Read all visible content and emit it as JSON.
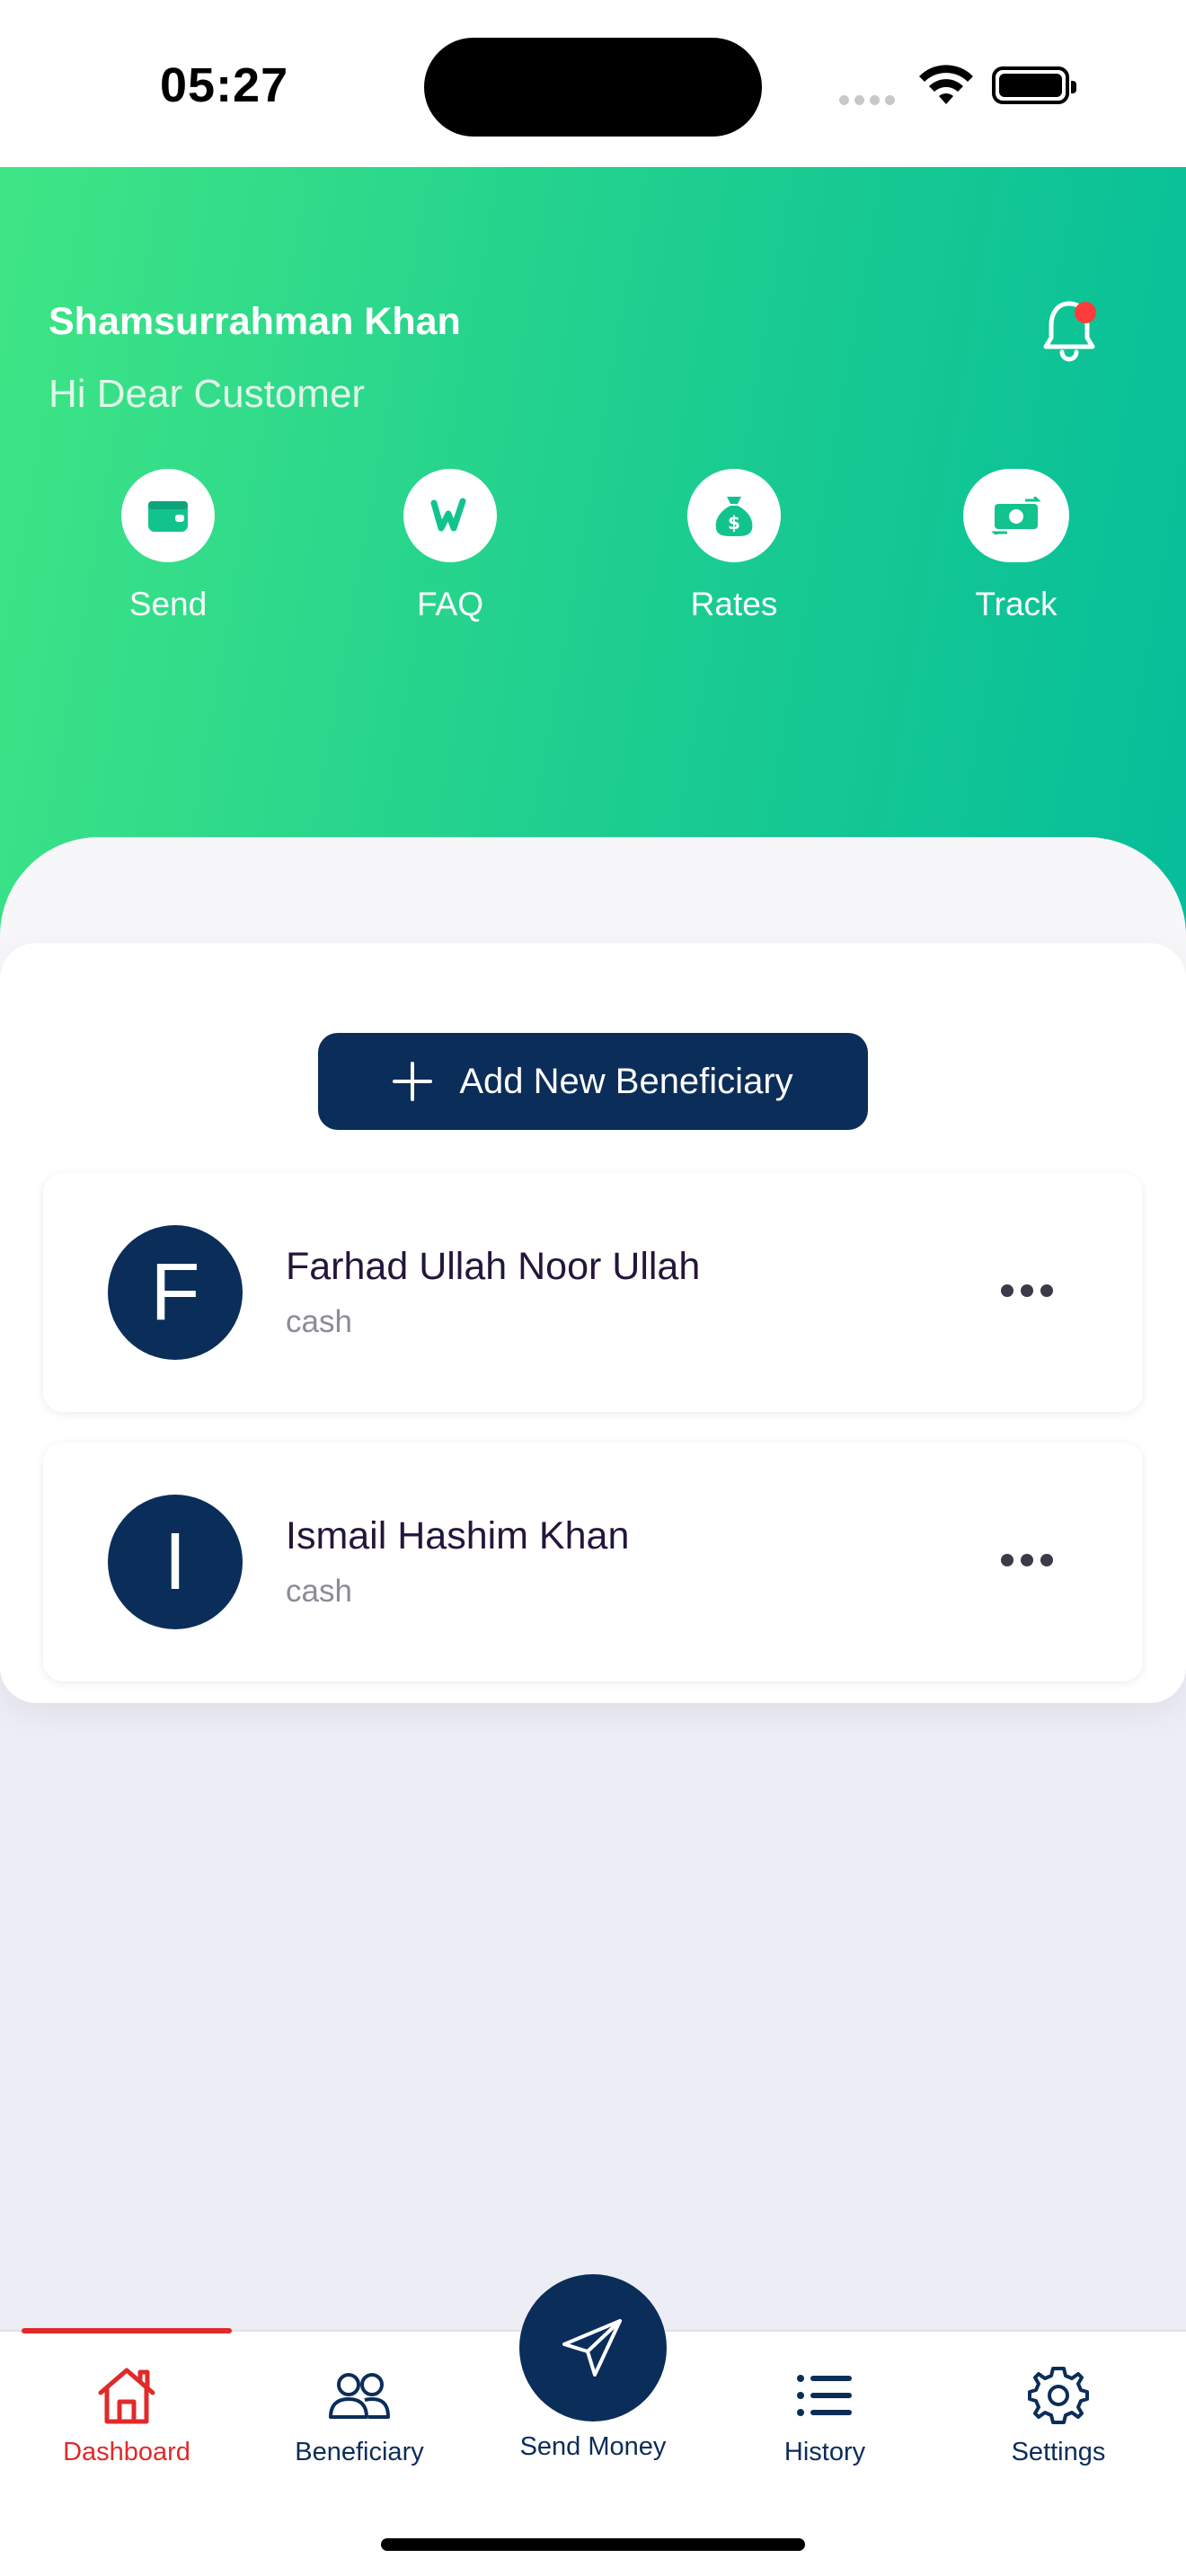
{
  "status_bar": {
    "time": "05:27"
  },
  "header": {
    "user_name": "Shamsurrahman Khan",
    "greeting": "Hi Dear Customer",
    "quick_actions": [
      {
        "label": "Send",
        "icon": "wallet-icon"
      },
      {
        "label": "FAQ",
        "icon": "faq-icon"
      },
      {
        "label": "Rates",
        "icon": "money-bag-icon"
      },
      {
        "label": "Track",
        "icon": "money-transfer-icon"
      }
    ]
  },
  "main": {
    "add_button_label": "Add New Beneficiary",
    "beneficiaries": [
      {
        "initial": "F",
        "name": "Farhad Ullah Noor Ullah",
        "type": "cash"
      },
      {
        "initial": "I",
        "name": "Ismail Hashim Khan",
        "type": "cash"
      }
    ]
  },
  "bottom_nav": {
    "items": [
      {
        "label": "Dashboard",
        "icon": "home-icon",
        "active": true
      },
      {
        "label": "Beneficiary",
        "icon": "users-icon",
        "active": false
      },
      {
        "label": "Send Money",
        "icon": "paper-plane-icon",
        "active": false
      },
      {
        "label": "History",
        "icon": "list-icon",
        "active": false
      },
      {
        "label": "Settings",
        "icon": "gear-icon",
        "active": false
      }
    ]
  },
  "colors": {
    "brand_navy": "#0b2d59",
    "gradient_start": "#3fe585",
    "gradient_end": "#05bd9a",
    "active_red": "#e02a2a",
    "notification_dot": "#ff3b3b"
  }
}
